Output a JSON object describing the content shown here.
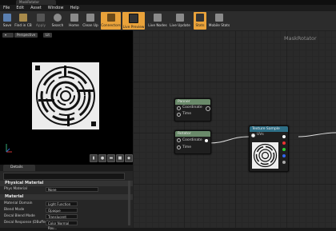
{
  "window": {
    "tab_title": "MaskRotator"
  },
  "menu": {
    "items": [
      "File",
      "Edit",
      "Asset",
      "Window",
      "Help"
    ]
  },
  "toolbar": {
    "buttons": [
      {
        "label": "Save",
        "icon": "save-icon"
      },
      {
        "label": "Find in CB",
        "icon": "find-in-cb-icon"
      },
      {
        "label": "Apply",
        "icon": "apply-icon"
      },
      {
        "label": "Search",
        "icon": "search-icon"
      },
      {
        "label": "Home",
        "icon": "home-icon"
      },
      {
        "label": "Clean Up",
        "icon": "clean-up-icon"
      },
      {
        "label": "Connectors",
        "icon": "connectors-icon"
      },
      {
        "label": "Live Preview",
        "icon": "live-preview-icon"
      },
      {
        "label": "Live Nodes",
        "icon": "live-nodes-icon"
      },
      {
        "label": "Live Update",
        "icon": "live-update-icon"
      },
      {
        "label": "Stats",
        "icon": "stats-icon"
      },
      {
        "label": "Mobile Stats",
        "icon": "mobile-stats-icon"
      }
    ],
    "accent": "#e9a23a"
  },
  "viewport": {
    "perspective_label": "Perspective",
    "lit_label": "Lit"
  },
  "details": {
    "tab_label": "Details",
    "sections": {
      "physical": "Physical Material",
      "material": "Material"
    },
    "phys_material": {
      "name": "Phys Material",
      "value": "None"
    },
    "props": [
      {
        "name": "Material Domain",
        "value": "Light Function"
      },
      {
        "name": "Blend Mode",
        "value": "Opaque"
      },
      {
        "name": "Decal Blend Mode",
        "value": "Translucent"
      },
      {
        "name": "Decal Response (DBuffer)",
        "value": "Color Normal Rou..."
      }
    ]
  },
  "graph": {
    "title": "MaskRotator",
    "nodes": {
      "panner": {
        "title": "Panner",
        "pins": [
          "Coordinate",
          "Time"
        ]
      },
      "rotator": {
        "title": "Rotator",
        "pins": [
          "Coordinate",
          "Time"
        ]
      },
      "texture": {
        "title": "Texture Sample",
        "pins": [
          "UVs"
        ]
      }
    },
    "colors": {
      "panner_header": "#6a8a6a",
      "rotator_header": "#6a8a6a",
      "texture_header": "#2e6f86"
    }
  }
}
